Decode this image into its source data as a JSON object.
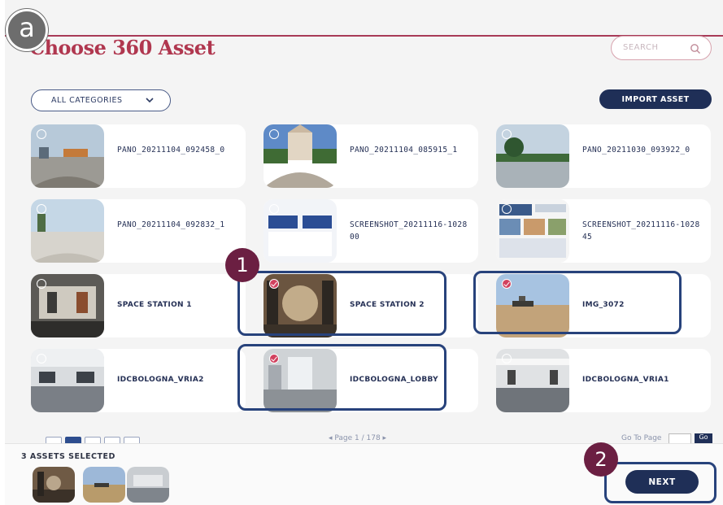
{
  "header": {
    "title": "Choose 360 Asset"
  },
  "search": {
    "placeholder": "SEARCH"
  },
  "filters": {
    "category_label": "ALL CATEGORIES"
  },
  "toolbar": {
    "import_label": "IMPORT ASSET"
  },
  "assets": [
    {
      "name": "PANO_20211104_092458_0",
      "selected": false,
      "thumb": "pano-harbor"
    },
    {
      "name": "PANO_20211104_085915_1",
      "selected": false,
      "thumb": "pano-church"
    },
    {
      "name": "PANO_20211030_093922_0",
      "selected": false,
      "thumb": "pano-lake"
    },
    {
      "name": "PANO_20211104_092832_1",
      "selected": false,
      "thumb": "pano-beach"
    },
    {
      "name": "SCREENSHOT_20211116-102800",
      "selected": false,
      "thumb": "screenshot-app"
    },
    {
      "name": "SCREENSHOT_20211116-102845",
      "selected": false,
      "thumb": "screenshot-web"
    },
    {
      "name": "SPACE STATION 1",
      "selected": false,
      "thumb": "space-station"
    },
    {
      "name": "SPACE STATION 2",
      "selected": true,
      "thumb": "space-station-2"
    },
    {
      "name": "IMG_3072",
      "selected": true,
      "thumb": "sea-boat"
    },
    {
      "name": "IDCBOLOGNA_VRIA2",
      "selected": false,
      "thumb": "office-room"
    },
    {
      "name": "IDCBOLOGNA_LOBBY",
      "selected": true,
      "thumb": "lobby"
    },
    {
      "name": "IDCBOLOGNA_VRIA1",
      "selected": false,
      "thumb": "office-room-2"
    }
  ],
  "pagination": {
    "page_text": "◂  Page 1 / 178  ▸",
    "goto_label": "Go To Page",
    "go_label": "Go"
  },
  "selection": {
    "count_label": "3 ASSETS SELECTED"
  },
  "footer": {
    "next_label": "NEXT"
  },
  "annotations": {
    "corner_badge": "a",
    "step1": "1",
    "step2": "2"
  },
  "colors": {
    "brand": "#b0374f",
    "navy": "#1f2f57",
    "highlight": "#27427b",
    "badge": "#6b1f42",
    "check": "#d1415e"
  },
  "icons": {
    "search": "search-icon",
    "chevron": "chevron-down-icon",
    "check": "check-icon"
  }
}
